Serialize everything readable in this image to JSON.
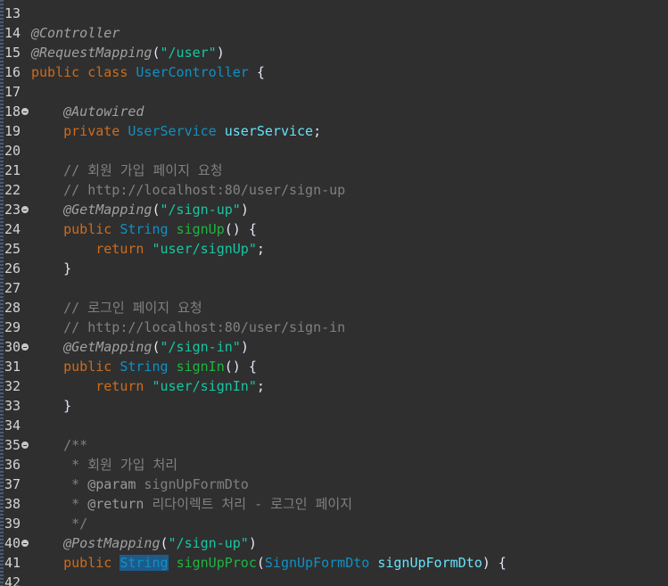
{
  "editor": {
    "lines": [
      {
        "n": "13",
        "fold": false,
        "tokens": []
      },
      {
        "n": "14",
        "fold": false,
        "tokens": [
          {
            "c": "annot",
            "t": "@Controller"
          }
        ]
      },
      {
        "n": "15",
        "fold": false,
        "tokens": [
          {
            "c": "annot",
            "t": "@RequestMapping"
          },
          {
            "c": "plain",
            "t": "("
          },
          {
            "c": "str",
            "t": "\"/user\""
          },
          {
            "c": "plain",
            "t": ")"
          }
        ]
      },
      {
        "n": "16",
        "fold": false,
        "tokens": [
          {
            "c": "kw",
            "t": "public class "
          },
          {
            "c": "type",
            "t": "UserController"
          },
          {
            "c": "plain",
            "t": " {"
          }
        ]
      },
      {
        "n": "17",
        "fold": false,
        "tokens": []
      },
      {
        "n": "18",
        "fold": true,
        "tokens": [
          {
            "c": "plain",
            "t": "    "
          },
          {
            "c": "annot",
            "t": "@Autowired"
          }
        ]
      },
      {
        "n": "19",
        "fold": false,
        "tokens": [
          {
            "c": "kw",
            "t": "    private "
          },
          {
            "c": "type",
            "t": "UserService"
          },
          {
            "c": "plain",
            "t": " "
          },
          {
            "c": "field",
            "t": "userService"
          },
          {
            "c": "plain",
            "t": ";"
          }
        ]
      },
      {
        "n": "20",
        "fold": false,
        "tokens": []
      },
      {
        "n": "21",
        "fold": false,
        "tokens": [
          {
            "c": "comment",
            "t": "    // 회원 가입 페이지 요청"
          }
        ]
      },
      {
        "n": "22",
        "fold": false,
        "tokens": [
          {
            "c": "comment",
            "t": "    // http://localhost:80/user/sign-up"
          }
        ]
      },
      {
        "n": "23",
        "fold": true,
        "tokens": [
          {
            "c": "plain",
            "t": "    "
          },
          {
            "c": "annot",
            "t": "@GetMapping"
          },
          {
            "c": "plain",
            "t": "("
          },
          {
            "c": "str",
            "t": "\"/sign-up\""
          },
          {
            "c": "plain",
            "t": ")"
          }
        ]
      },
      {
        "n": "24",
        "fold": false,
        "tokens": [
          {
            "c": "kw",
            "t": "    public "
          },
          {
            "c": "type",
            "t": "String"
          },
          {
            "c": "plain",
            "t": " "
          },
          {
            "c": "method",
            "t": "signUp"
          },
          {
            "c": "plain",
            "t": "() {"
          }
        ]
      },
      {
        "n": "25",
        "fold": false,
        "tokens": [
          {
            "c": "kw",
            "t": "        return "
          },
          {
            "c": "str",
            "t": "\"user/signUp\""
          },
          {
            "c": "plain",
            "t": ";"
          }
        ]
      },
      {
        "n": "26",
        "fold": false,
        "tokens": [
          {
            "c": "plain",
            "t": "    }"
          }
        ]
      },
      {
        "n": "27",
        "fold": false,
        "tokens": []
      },
      {
        "n": "28",
        "fold": false,
        "tokens": [
          {
            "c": "comment",
            "t": "    // 로그인 페이지 요청"
          }
        ]
      },
      {
        "n": "29",
        "fold": false,
        "tokens": [
          {
            "c": "comment",
            "t": "    // http://localhost:80/user/sign-in"
          }
        ]
      },
      {
        "n": "30",
        "fold": true,
        "tokens": [
          {
            "c": "plain",
            "t": "    "
          },
          {
            "c": "annot",
            "t": "@GetMapping"
          },
          {
            "c": "plain",
            "t": "("
          },
          {
            "c": "str",
            "t": "\"/sign-in\""
          },
          {
            "c": "plain",
            "t": ")"
          }
        ]
      },
      {
        "n": "31",
        "fold": false,
        "tokens": [
          {
            "c": "kw",
            "t": "    public "
          },
          {
            "c": "type",
            "t": "String"
          },
          {
            "c": "plain",
            "t": " "
          },
          {
            "c": "method",
            "t": "signIn"
          },
          {
            "c": "plain",
            "t": "() {"
          }
        ]
      },
      {
        "n": "32",
        "fold": false,
        "tokens": [
          {
            "c": "kw",
            "t": "        return "
          },
          {
            "c": "str",
            "t": "\"user/signIn\""
          },
          {
            "c": "plain",
            "t": ";"
          }
        ]
      },
      {
        "n": "33",
        "fold": false,
        "tokens": [
          {
            "c": "plain",
            "t": "    }"
          }
        ]
      },
      {
        "n": "34",
        "fold": false,
        "tokens": []
      },
      {
        "n": "35",
        "fold": true,
        "tokens": [
          {
            "c": "comment",
            "t": "    /**"
          }
        ]
      },
      {
        "n": "36",
        "fold": false,
        "tokens": [
          {
            "c": "comment",
            "t": "     * 회원 가입 처리"
          }
        ]
      },
      {
        "n": "37",
        "fold": false,
        "tokens": [
          {
            "c": "comment",
            "t": "     * "
          },
          {
            "c": "doctag",
            "t": "@param"
          },
          {
            "c": "comment",
            "t": " signUpFormDto"
          }
        ]
      },
      {
        "n": "38",
        "fold": false,
        "tokens": [
          {
            "c": "comment",
            "t": "     * "
          },
          {
            "c": "doctag",
            "t": "@return"
          },
          {
            "c": "comment",
            "t": " 리다이렉트 처리 - 로그인 페이지"
          }
        ]
      },
      {
        "n": "39",
        "fold": false,
        "tokens": [
          {
            "c": "comment",
            "t": "     */"
          }
        ]
      },
      {
        "n": "40",
        "fold": true,
        "tokens": [
          {
            "c": "plain",
            "t": "    "
          },
          {
            "c": "annot",
            "t": "@PostMapping"
          },
          {
            "c": "plain",
            "t": "("
          },
          {
            "c": "str",
            "t": "\"/sign-up\""
          },
          {
            "c": "plain",
            "t": ")"
          }
        ]
      },
      {
        "n": "41",
        "fold": false,
        "tokens": [
          {
            "c": "kw",
            "t": "    public "
          },
          {
            "c": "sel",
            "t": "String"
          },
          {
            "c": "plain",
            "t": " "
          },
          {
            "c": "method",
            "t": "signUpProc"
          },
          {
            "c": "plain",
            "t": "("
          },
          {
            "c": "type",
            "t": "SignUpFormDto"
          },
          {
            "c": "plain",
            "t": " "
          },
          {
            "c": "field",
            "t": "signUpFormDto"
          },
          {
            "c": "plain",
            "t": ") {"
          }
        ]
      },
      {
        "n": "42",
        "fold": false,
        "tokens": []
      }
    ]
  }
}
